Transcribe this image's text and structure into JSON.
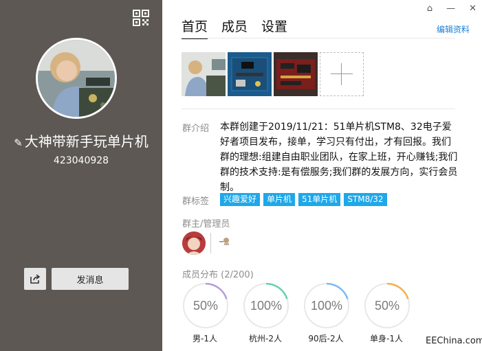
{
  "group": {
    "name": "大神带新手玩单片机",
    "id": "423040928"
  },
  "actions": {
    "send_message": "发消息"
  },
  "tabs": [
    "首页",
    "成员",
    "设置"
  ],
  "edit_profile": "编辑资料",
  "intro": {
    "label": "群介绍",
    "text": "本群创建于2019/11/21：51单片机STM8、32电子爱好者项目发布，接单，学习只有付出，才有回报。我们群的理想:组建自由职业团队，在家上班，开心赚钱;我们群的技术支持:是有偿服务;我们群的发展方向，实行会员制。"
  },
  "tags": {
    "label": "群标签",
    "items": [
      "兴趣爱好",
      "单片机",
      "51单片机",
      "STM8/32"
    ]
  },
  "admins": {
    "label": "群主/管理员"
  },
  "members": {
    "label": "成员分布",
    "count": "(2/200)",
    "stats": [
      {
        "percent": "50%",
        "value": 0.5,
        "label": "男-1人",
        "color": "#b39ddb"
      },
      {
        "percent": "100%",
        "value": 1.0,
        "label": "杭州-2人",
        "color": "#64d2a6"
      },
      {
        "percent": "100%",
        "value": 1.0,
        "label": "90后-2人",
        "color": "#7db8f0"
      },
      {
        "percent": "50%",
        "value": 0.5,
        "label": "单身-1人",
        "color": "#f3b04a"
      }
    ]
  },
  "watermark": "EEChina.com",
  "colors": {
    "sidebar": "#5d5853",
    "tag": "#1ea8ea",
    "link": "#1e7fd6"
  }
}
